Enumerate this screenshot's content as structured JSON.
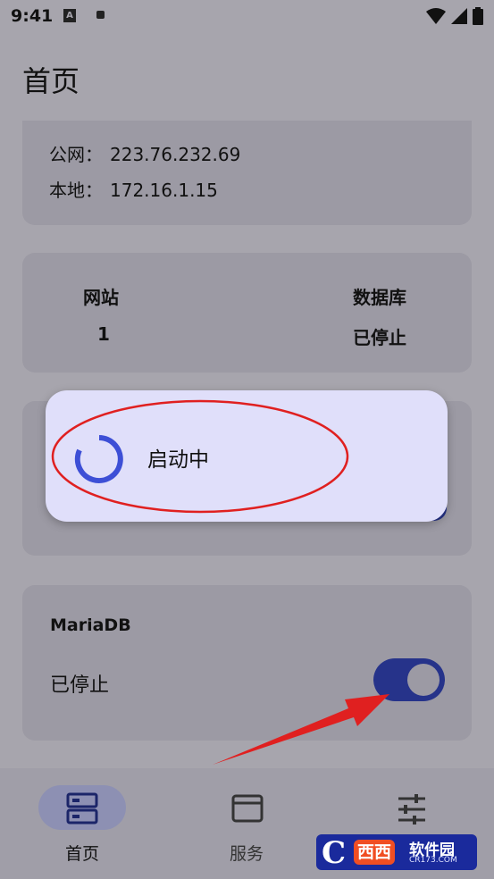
{
  "status_bar": {
    "time": "9:41",
    "notification_a": "A"
  },
  "header": {
    "title": "首页"
  },
  "ip_card": {
    "public_label": "公网：",
    "public_value": "223.76.232.69",
    "local_label": "本地：",
    "local_value": "172.16.1.15"
  },
  "stats_card": {
    "website_label": "网站",
    "website_value": "1",
    "database_label": "数据库",
    "database_value": "已停止"
  },
  "mariadb_card": {
    "name": "MariaDB",
    "status": "已停止",
    "toggle_on": true
  },
  "loading_dialog": {
    "text": "启动中"
  },
  "bottom_nav": {
    "items": [
      {
        "label": "首页",
        "icon": "server-icon",
        "active": true
      },
      {
        "label": "服务",
        "icon": "window-icon",
        "active": false
      },
      {
        "label": "",
        "icon": "sliders-icon",
        "active": false
      }
    ]
  },
  "watermark": {
    "logo_letter": "C",
    "brand": "西西",
    "site_name": "软件园",
    "url": "CR173.COM"
  },
  "colors": {
    "accent": "#26338a",
    "dialog_bg": "#e0dffa",
    "spinner": "#3d4fd6",
    "annotation_red": "#e02020"
  }
}
